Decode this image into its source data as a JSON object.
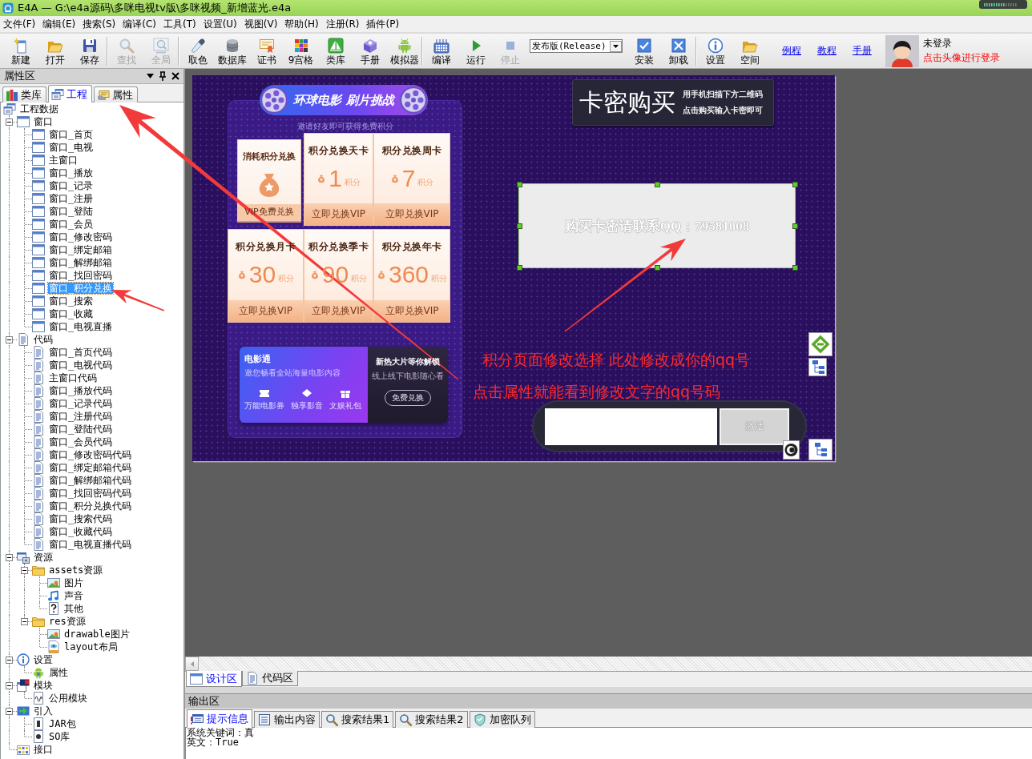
{
  "window": {
    "title": "E4A — G:\\e4a源码\\多咪电视tv版\\多咪视频_新增蓝光.e4a"
  },
  "menu": [
    "文件(F)",
    "编辑(E)",
    "搜索(S)",
    "编译(C)",
    "工具(T)",
    "设置(U)",
    "视图(V)",
    "帮助(H)",
    "注册(R)",
    "插件(P)"
  ],
  "toolbar": {
    "groups": [
      [
        {
          "kind": "button",
          "label": "新建",
          "disabled": false
        },
        {
          "kind": "button",
          "label": "打开",
          "disabled": false
        },
        {
          "kind": "button",
          "label": "保存",
          "disabled": false
        }
      ],
      [
        {
          "kind": "button",
          "label": "查找",
          "disabled": true
        },
        {
          "kind": "button",
          "label": "全局",
          "disabled": true
        }
      ],
      [
        {
          "kind": "button",
          "label": "取色",
          "disabled": false
        },
        {
          "kind": "button",
          "label": "数据库",
          "disabled": false
        },
        {
          "kind": "button",
          "label": "证书",
          "disabled": false
        },
        {
          "kind": "button",
          "label": "9宫格",
          "disabled": false
        },
        {
          "kind": "button",
          "label": "类库",
          "disabled": false
        },
        {
          "kind": "button",
          "label": "手册",
          "disabled": false
        },
        {
          "kind": "button",
          "label": "模拟器",
          "disabled": false
        }
      ],
      [
        {
          "kind": "button",
          "label": "编译",
          "disabled": false
        },
        {
          "kind": "button",
          "label": "运行",
          "disabled": false
        },
        {
          "kind": "button",
          "label": "停止",
          "disabled": true
        },
        {
          "kind": "dropdown",
          "value": "发布版(Release)"
        },
        {
          "kind": "button",
          "label": "安装",
          "disabled": false
        },
        {
          "kind": "button",
          "label": "卸载",
          "disabled": false
        }
      ],
      [
        {
          "kind": "button",
          "label": "设置",
          "disabled": false
        },
        {
          "kind": "button",
          "label": "空间",
          "disabled": false
        }
      ]
    ],
    "links": [
      "例程",
      "教程",
      "手册"
    ],
    "account": {
      "status": "未登录",
      "hint": "点击头像进行登录"
    }
  },
  "side_panel": {
    "title": "属性区",
    "tabs": [
      {
        "label": "类库",
        "selected": false
      },
      {
        "label": "工程",
        "selected": true
      },
      {
        "label": "属性",
        "selected": false
      }
    ],
    "tree": [
      {
        "label": "工程数据",
        "kind": "project",
        "selected": false,
        "children": [
          {
            "label": "窗口",
            "kind": "window",
            "selected": false,
            "expanded": true,
            "children": [
              {
                "label": "窗口_首页",
                "kind": "window",
                "selected": false
              },
              {
                "label": "窗口_电视",
                "kind": "window",
                "selected": false
              },
              {
                "label": "主窗口",
                "kind": "window",
                "selected": false
              },
              {
                "label": "窗口_播放",
                "kind": "window",
                "selected": false
              },
              {
                "label": "窗口_记录",
                "kind": "window",
                "selected": false
              },
              {
                "label": "窗口_注册",
                "kind": "window",
                "selected": false
              },
              {
                "label": "窗口_登陆",
                "kind": "window",
                "selected": false
              },
              {
                "label": "窗口_会员",
                "kind": "window",
                "selected": false
              },
              {
                "label": "窗口_修改密码",
                "kind": "window",
                "selected": false
              },
              {
                "label": "窗口_绑定邮箱",
                "kind": "window",
                "selected": false
              },
              {
                "label": "窗口_解绑邮箱",
                "kind": "window",
                "selected": false
              },
              {
                "label": "窗口_找回密码",
                "kind": "window",
                "selected": false
              },
              {
                "label": "窗口_积分兑换",
                "kind": "window",
                "selected": true
              },
              {
                "label": "窗口_搜索",
                "kind": "window",
                "selected": false
              },
              {
                "label": "窗口_收藏",
                "kind": "window",
                "selected": false
              },
              {
                "label": "窗口_电视直播",
                "kind": "window",
                "selected": false
              }
            ]
          },
          {
            "label": "代码",
            "kind": "code",
            "selected": false,
            "expanded": true,
            "children": [
              {
                "label": "窗口_首页代码",
                "kind": "code",
                "selected": false
              },
              {
                "label": "窗口_电视代码",
                "kind": "code",
                "selected": false
              },
              {
                "label": "主窗口代码",
                "kind": "code",
                "selected": false
              },
              {
                "label": "窗口_播放代码",
                "kind": "code",
                "selected": false
              },
              {
                "label": "窗口_记录代码",
                "kind": "code",
                "selected": false
              },
              {
                "label": "窗口_注册代码",
                "kind": "code",
                "selected": false
              },
              {
                "label": "窗口_登陆代码",
                "kind": "code",
                "selected": false
              },
              {
                "label": "窗口_会员代码",
                "kind": "code",
                "selected": false
              },
              {
                "label": "窗口_修改密码代码",
                "kind": "code",
                "selected": false
              },
              {
                "label": "窗口_绑定邮箱代码",
                "kind": "code",
                "selected": false
              },
              {
                "label": "窗口_解绑邮箱代码",
                "kind": "code",
                "selected": false
              },
              {
                "label": "窗口_找回密码代码",
                "kind": "code",
                "selected": false
              },
              {
                "label": "窗口_积分兑换代码",
                "kind": "code",
                "selected": false
              },
              {
                "label": "窗口_搜索代码",
                "kind": "code",
                "selected": false
              },
              {
                "label": "窗口_收藏代码",
                "kind": "code",
                "selected": false
              },
              {
                "label": "窗口_电视直播代码",
                "kind": "code",
                "selected": false
              }
            ]
          },
          {
            "label": "资源",
            "kind": "resources",
            "selected": false,
            "expanded": true,
            "children": [
              {
                "label": "assets资源",
                "kind": "folder",
                "selected": false,
                "expanded": true,
                "children": [
                  {
                    "label": "图片",
                    "kind": "image",
                    "selected": false
                  },
                  {
                    "label": "声音",
                    "kind": "audio",
                    "selected": false
                  },
                  {
                    "label": "其他",
                    "kind": "other",
                    "selected": false
                  }
                ]
              },
              {
                "label": "res资源",
                "kind": "folder",
                "selected": false,
                "expanded": true,
                "children": [
                  {
                    "label": "drawable图片",
                    "kind": "image",
                    "selected": false
                  },
                  {
                    "label": "layout布局",
                    "kind": "layout",
                    "selected": false
                  }
                ]
              }
            ]
          },
          {
            "label": "设置",
            "kind": "settings",
            "selected": false,
            "expanded": true,
            "children": [
              {
                "label": "属性",
                "kind": "property",
                "selected": false
              }
            ]
          },
          {
            "label": "模块",
            "kind": "modules",
            "selected": false,
            "expanded": true,
            "children": [
              {
                "label": "公用模块",
                "kind": "module",
                "selected": false
              }
            ]
          },
          {
            "label": "引入",
            "kind": "import",
            "selected": false,
            "expanded": true,
            "children": [
              {
                "label": "JAR包",
                "kind": "jar",
                "selected": false
              },
              {
                "label": "SO库",
                "kind": "so",
                "selected": false
              }
            ]
          },
          {
            "label": "接口",
            "kind": "interface",
            "selected": false
          }
        ]
      }
    ]
  },
  "designer": {
    "canvas": {
      "banner": {
        "title": "环球电影 刷片挑战"
      },
      "invite_hint": "邀请好友即可获得免费积分",
      "free_offer": {
        "title": "消耗积分兑换",
        "action": "VIP免费兑换"
      },
      "offers": [
        {
          "title": "积分兑换天卡",
          "amount": "1",
          "unit": "积分",
          "action": "立即兑换VIP"
        },
        {
          "title": "积分兑换周卡",
          "amount": "7",
          "unit": "积分",
          "action": "立即兑换VIP"
        },
        {
          "title": "积分兑换月卡",
          "amount": "30",
          "unit": "积分",
          "action": "立即兑换VIP"
        },
        {
          "title": "积分兑换季卡",
          "amount": "90",
          "unit": "积分",
          "action": "立即兑换VIP"
        },
        {
          "title": "积分兑换年卡",
          "amount": "360",
          "unit": "积分",
          "action": "立即兑换VIP"
        }
      ],
      "promo": {
        "title": "电影通",
        "subtitle": "邀您畅看全站海量电影内容",
        "perks": [
          "万能电影券",
          "独享影音",
          "文娱礼包"
        ],
        "headline": "新热大片等你解锁",
        "tagline": "线上线下电影随心看",
        "button": "免费兑换"
      },
      "purchase_header": {
        "title": "卡密购买",
        "lines": [
          "用手机扫描下方二维码",
          "点击购买输入卡密即可"
        ]
      },
      "contact_label": {
        "text": "购买卡密请联系QQ：79581008",
        "selected": true
      },
      "annotations": [
        "积分页面修改选择 此处修改成你的qq号",
        "点击属性就能看到修改文字的qq号码"
      ],
      "activation": {
        "button": "激活"
      }
    },
    "tabs": [
      {
        "label": "设计区",
        "selected": true
      },
      {
        "label": "代码区",
        "selected": false
      }
    ]
  },
  "output": {
    "title": "输出区",
    "tabs": [
      {
        "label": "提示信息",
        "selected": true
      },
      {
        "label": "输出内容",
        "selected": false
      },
      {
        "label": "搜索结果1",
        "selected": false
      },
      {
        "label": "搜索结果2",
        "selected": false
      },
      {
        "label": "加密队列",
        "selected": false
      }
    ],
    "lines": [
      "系统关键词：真",
      "英文：True"
    ]
  }
}
